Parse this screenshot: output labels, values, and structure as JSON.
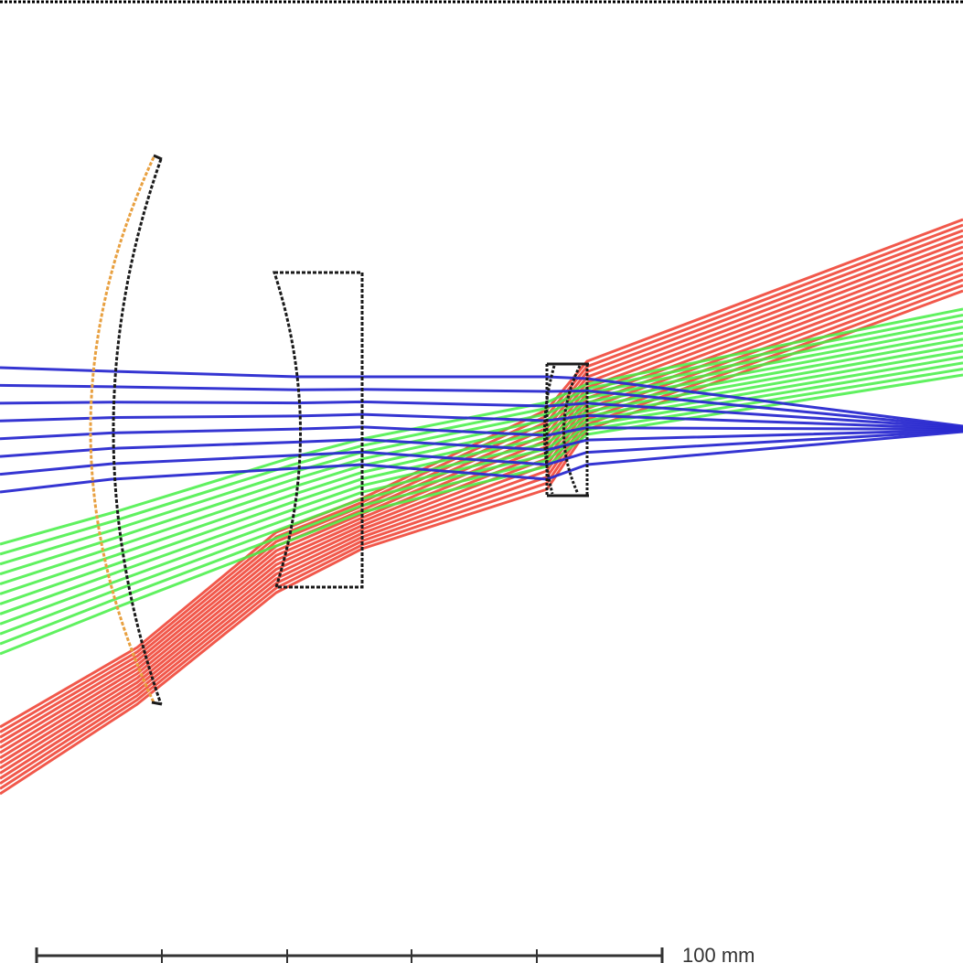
{
  "scale_bar": {
    "label": "100 mm"
  },
  "colors": {
    "background": "#ffffff",
    "lens_outline": "#1a1a1a",
    "mirror_highlight": "#e8a040",
    "ray_on_axis": "#2a2ad0",
    "ray_mid_field": "#44ee44",
    "ray_full_field": "#ee3b2b",
    "scale_bar": "#333333"
  },
  "elements": [
    {
      "name": "meniscus-lens",
      "kind": "lens"
    },
    {
      "name": "plano-concave-lens",
      "kind": "lens"
    },
    {
      "name": "cemented-doublet",
      "kind": "lens"
    }
  ],
  "ray_fields": [
    {
      "name": "on-axis",
      "color": "#2a2ad0"
    },
    {
      "name": "mid-field",
      "color": "#44ee44"
    },
    {
      "name": "full-field",
      "color": "#ee3b2b"
    }
  ]
}
